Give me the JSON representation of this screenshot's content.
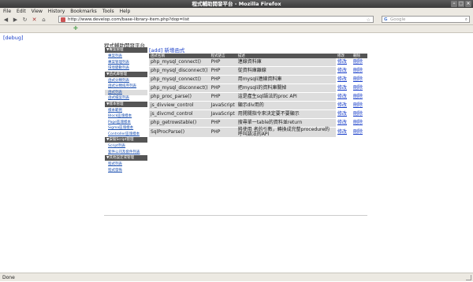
{
  "window": {
    "title": "程式輔助開發平台 - Mozilla Firefox"
  },
  "menu": [
    "File",
    "Edit",
    "View",
    "History",
    "Bookmarks",
    "Tools",
    "Help"
  ],
  "toolbar": {
    "url": "http://www.develop.com/base-library-item.php?dop=list",
    "search_placeholder": "Google"
  },
  "page": {
    "debug_link": "[debug]",
    "site_title": "程式輔助開發平台",
    "add_link": "[add] 新增函式"
  },
  "sidebar": [
    {
      "title": "▼專案管理",
      "items": [
        "專案列表",
        "專案管理列表",
        "環境變數列表"
      ],
      "active": -1
    },
    {
      "title": "▼函式庫管理",
      "items": [
        "函式分類列表",
        "函式分類排序列表",
        "函式列表",
        "函式檔案列表"
      ],
      "active": 2
    },
    {
      "title": "▼樣本管理",
      "items": [
        "樣本範例",
        "Block區塊樣本",
        "Page區塊樣本",
        "Sigma區塊樣本",
        "Controller區塊樣本"
      ],
      "active": -1
    },
    {
      "title": "▼安裝Script管理",
      "items": [
        "Script列表",
        "套件公司及套件列表"
      ],
      "active": -1
    },
    {
      "title": "▼其他設定或管理",
      "items": [
        "程式列表",
        "程式發佈"
      ],
      "active": -1
    }
  ],
  "table": {
    "headers": [
      "函式名稱",
      "程式語言",
      "描述",
      "修改",
      "刪除"
    ],
    "rows": [
      {
        "name": "php_mysql_connect()",
        "lang": "PHP",
        "desc": "連線資料庫",
        "edit": "修改",
        "del": "刪除"
      },
      {
        "name": "php_mysql_disconnect()",
        "lang": "PHP",
        "desc": "從資料庫離線",
        "edit": "修改",
        "del": "刪除"
      },
      {
        "name": "php_mysql_connect()",
        "lang": "PHP",
        "desc": "用mysqli連線資料庫",
        "edit": "修改",
        "del": "刪除"
      },
      {
        "name": "php_mysql_disconnect()",
        "lang": "PHP",
        "desc": "把mysqli的資料庫關掉",
        "edit": "修改",
        "del": "刪除"
      },
      {
        "name": "php_proc_parse()",
        "lang": "PHP",
        "desc": "這是產生sql語法的proc API",
        "edit": "修改",
        "del": "刪除"
      },
      {
        "name": "js_divview_control",
        "lang": "JavaScript",
        "desc": "顯示div用的",
        "edit": "修改",
        "del": "刪除"
      },
      {
        "name": "js_divcmd_control",
        "lang": "JavaScript",
        "desc": "用開關指令來決定要不要顯示",
        "edit": "修改",
        "del": "刪除"
      },
      {
        "name": "php_getrowstable()",
        "lang": "PHP",
        "desc": "搜尋單一table的資料並return",
        "edit": "修改",
        "del": "刪除"
      },
      {
        "name": "SqlProcParse()",
        "lang": "PHP",
        "desc": "將使用 者的引數，轉換成完整procedure的呼叫語法的API",
        "edit": "修改",
        "del": "刪除"
      }
    ]
  },
  "status": "Done"
}
